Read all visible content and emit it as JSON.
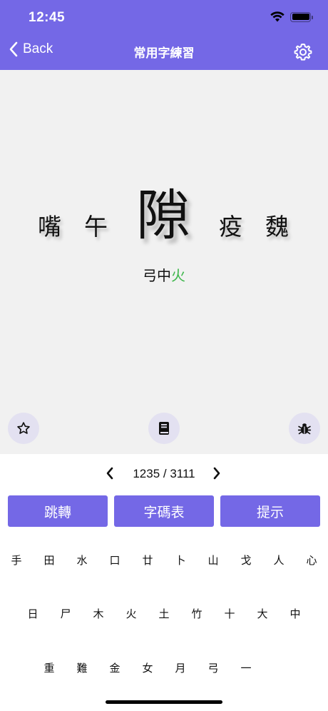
{
  "status_bar": {
    "time": "12:45"
  },
  "nav": {
    "back_label": "Back",
    "title": "常用字練習"
  },
  "practice": {
    "chars": {
      "c1": "嘴",
      "c2": "午",
      "current": "隙",
      "c4": "疫",
      "c5": "魏"
    },
    "codes_plain": "弓中",
    "codes_hint": "火"
  },
  "pager": {
    "text": "1235 / 3111"
  },
  "actions": {
    "jump": "跳轉",
    "code_table": "字碼表",
    "hint": "提示"
  },
  "keyboard": {
    "row1": [
      "手",
      "田",
      "水",
      "口",
      "廿",
      "卜",
      "山",
      "戈",
      "人",
      "心"
    ],
    "row2": [
      "日",
      "尸",
      "木",
      "火",
      "土",
      "竹",
      "十",
      "大",
      "中"
    ],
    "row3": [
      "重",
      "難",
      "金",
      "女",
      "月",
      "弓",
      "一"
    ]
  },
  "colors": {
    "accent": "#7468e6",
    "hint_green": "#3cb64a",
    "practice_bg": "#f1f1f1",
    "round_button_bg": "#e3e1f1"
  },
  "icons": {
    "back": "chevron-left-icon",
    "settings": "gear-icon",
    "favorite": "star-icon",
    "dictionary": "book-icon",
    "report": "bug-icon"
  }
}
